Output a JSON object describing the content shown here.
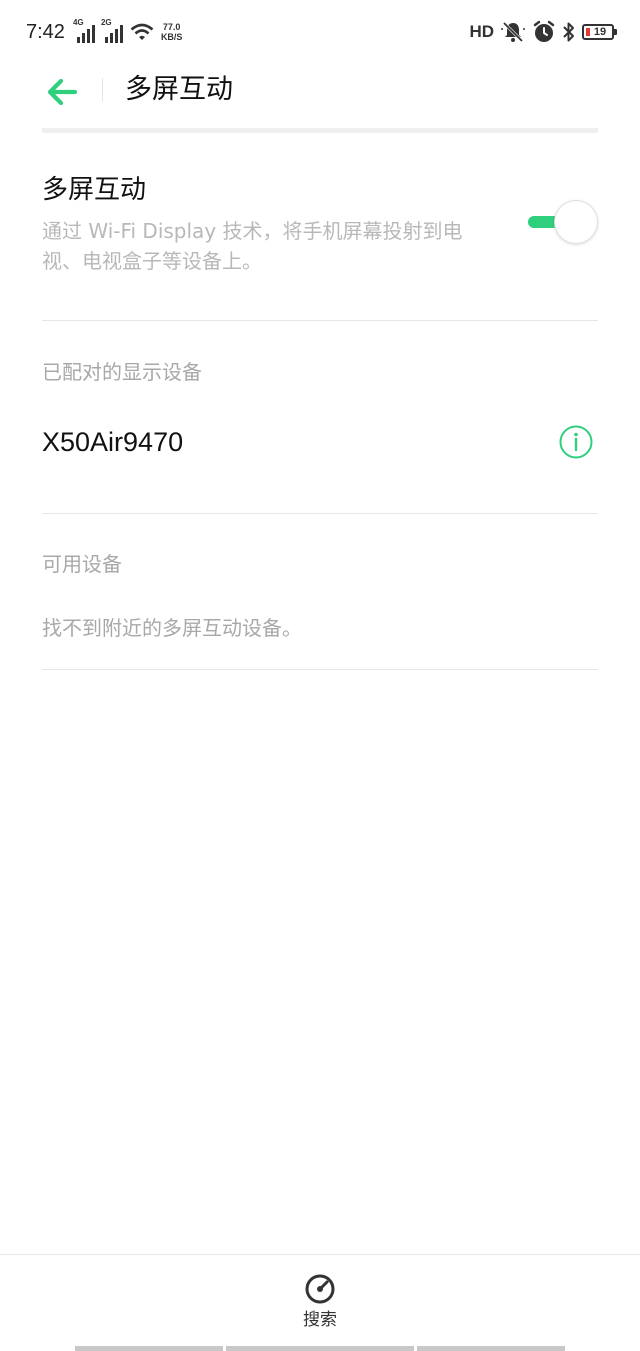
{
  "status_bar": {
    "time": "7:42",
    "sim1_type": "4G",
    "sim2_type": "2G",
    "net_speed_value": "77.0",
    "net_speed_unit": "KB/S",
    "hd_label": "HD",
    "battery_level": "19",
    "battery_color": "#e53935",
    "icons": [
      "signal-icon",
      "wifi-icon",
      "mute-icon",
      "alarm-icon",
      "bluetooth-icon",
      "battery-icon"
    ]
  },
  "header": {
    "title": "多屏互动",
    "back_icon": "arrow-left-icon"
  },
  "toggle": {
    "title": "多屏互动",
    "description": "通过 Wi-Fi Display 技术，将手机屏幕投射到电视、电视盒子等设备上。",
    "enabled": true
  },
  "paired": {
    "section_title": "已配对的显示设备",
    "devices": [
      {
        "name": "X50Air9470",
        "icon": "info-icon"
      }
    ]
  },
  "available": {
    "section_title": "可用设备",
    "empty_message": "找不到附近的多屏互动设备。"
  },
  "bottom": {
    "search_label": "搜索",
    "search_icon": "search-radar-icon"
  },
  "colors": {
    "accent": "#2fcf7d",
    "text_primary": "#111111",
    "text_secondary": "#a8a8a8"
  }
}
